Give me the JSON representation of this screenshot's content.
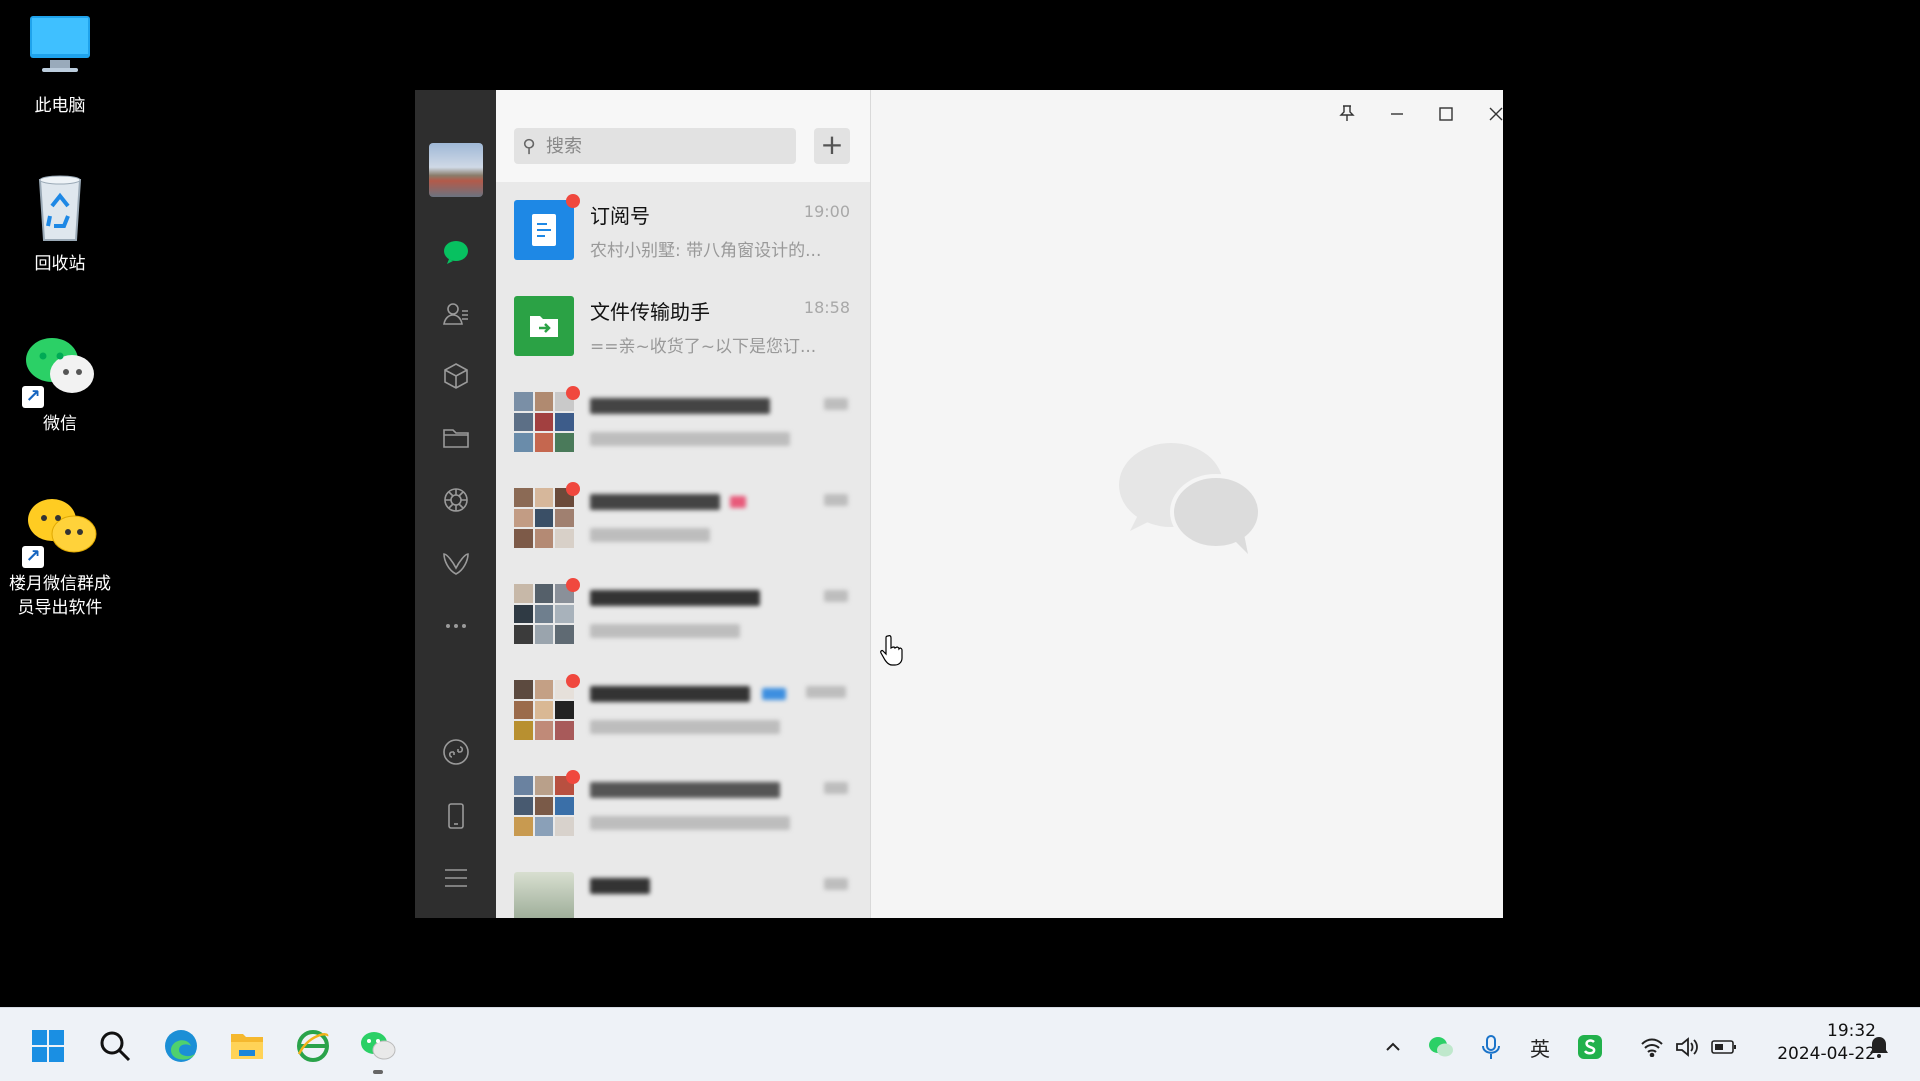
{
  "desktop": {
    "icons": [
      {
        "label": "此电脑",
        "icon": "computer-icon"
      },
      {
        "label": "回收站",
        "icon": "recycle-bin-icon"
      },
      {
        "label": "微信",
        "icon": "wechat-icon"
      },
      {
        "label": "楼月微信群成员导出软件",
        "label_line1": "楼月微信群成",
        "label_line2": "员导出软件",
        "icon": "exporter-icon"
      }
    ]
  },
  "wechat": {
    "search_placeholder": "搜索",
    "add_label": "+",
    "nav": [
      "chat-icon",
      "contacts-icon",
      "favorites-box-icon",
      "folder-icon",
      "moments-icon",
      "channels-icon",
      "more-icon",
      "mini-program-icon",
      "phone-icon",
      "menu-icon"
    ],
    "conversations": [
      {
        "name": "订阅号",
        "time": "19:00",
        "message": "农村小别墅: 带八角窗设计的...",
        "unread": true,
        "avatar_color": "#1e88e5"
      },
      {
        "name": "文件传输助手",
        "time": "18:58",
        "message": "==亲~收货了~以下是您订...",
        "unread": false,
        "avatar_color": "#2ba245"
      }
    ],
    "window_controls": [
      "pin-icon",
      "minimize-icon",
      "maximize-icon",
      "close-icon"
    ]
  },
  "taskbar": {
    "apps": [
      "start-icon",
      "search-icon",
      "edge-icon",
      "file-explorer-icon",
      "ie-browser-icon",
      "wechat-icon"
    ],
    "tray": [
      "chevron-up-icon",
      "wechat-tray-icon",
      "microphone-icon",
      "ime-icon",
      "sogou-icon",
      "wifi-icon",
      "volume-icon",
      "battery-icon"
    ],
    "ime_label": "英",
    "time": "19:32",
    "date": "2024-04-22",
    "colors": {
      "accent": "#07c160",
      "brand_blue": "#0078d4"
    }
  }
}
